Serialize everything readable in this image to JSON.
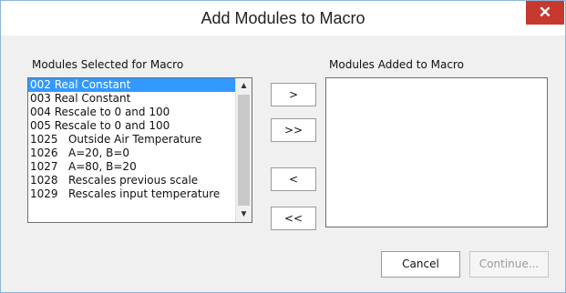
{
  "window": {
    "title": "Add Modules to Macro",
    "close_glyph": "✕"
  },
  "left_panel": {
    "label": "Modules Selected for Macro",
    "items": [
      {
        "text": "002 Real Constant",
        "selected": true
      },
      {
        "text": "003 Real Constant",
        "selected": false
      },
      {
        "text": "004 Rescale to 0 and 100",
        "selected": false
      },
      {
        "text": "005 Rescale to 0 and 100",
        "selected": false
      },
      {
        "text": "1025   Outside Air Temperature",
        "selected": false
      },
      {
        "text": "1026   A=20, B=0",
        "selected": false
      },
      {
        "text": "1027   A=80, B=20",
        "selected": false
      },
      {
        "text": "1028   Rescales previous scale",
        "selected": false
      },
      {
        "text": "1029   Rescales input temperature",
        "selected": false
      }
    ]
  },
  "right_panel": {
    "label": "Modules Added to Macro",
    "items": []
  },
  "transfer_buttons": {
    "add": ">",
    "add_all": ">>",
    "remove": "<",
    "remove_all": "<<"
  },
  "footer": {
    "cancel": "Cancel",
    "continue": "Continue..."
  },
  "colors": {
    "selection": "#3399ff",
    "close_button": "#c7392e"
  }
}
